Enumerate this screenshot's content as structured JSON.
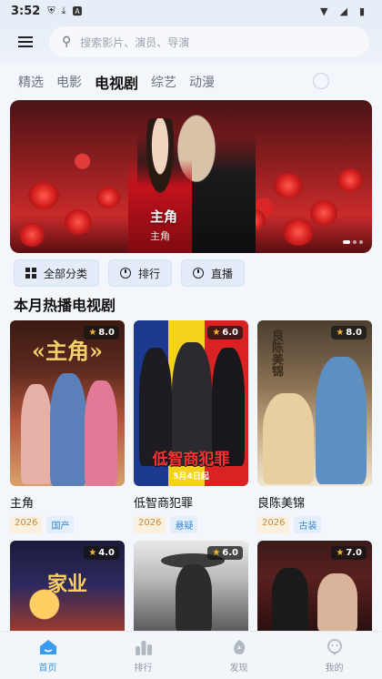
{
  "status_bar": {
    "time": "3:52"
  },
  "search": {
    "placeholder": "搜索影片、演员、导演"
  },
  "tabs": [
    {
      "label": "精选",
      "active": false
    },
    {
      "label": "电影",
      "active": false
    },
    {
      "label": "电视剧",
      "active": true
    },
    {
      "label": "综艺",
      "active": false
    },
    {
      "label": "动漫",
      "active": false
    }
  ],
  "banner": {
    "title": "主角",
    "subtitle": "主角"
  },
  "chips": [
    {
      "label": "全部分类",
      "icon": "grid-icon"
    },
    {
      "label": "排行",
      "icon": "clock-icon"
    },
    {
      "label": "直播",
      "icon": "clock-icon"
    }
  ],
  "section": {
    "title": "本月热播电视剧"
  },
  "cards": [
    {
      "name": "主角",
      "rating": "8.0",
      "year": "2026",
      "genre": "国产",
      "poster_text": "«主角»"
    },
    {
      "name": "低智商犯罪",
      "rating": "6.0",
      "year": "2026",
      "genre": "悬疑",
      "poster_text": "低智商犯罪",
      "poster_date": "5月4日起"
    },
    {
      "name": "良陈美锦",
      "rating": "8.0",
      "year": "2026",
      "genre": "古装",
      "poster_text": "良陈美锦"
    },
    {
      "name": "",
      "rating": "4.0",
      "poster_text": "家业"
    },
    {
      "name": "",
      "rating": "6.0"
    },
    {
      "name": "",
      "rating": "7.0"
    }
  ],
  "bottom_nav": [
    {
      "label": "首页",
      "icon": "home-icon",
      "active": true
    },
    {
      "label": "排行",
      "icon": "ranking-icon",
      "active": false
    },
    {
      "label": "发现",
      "icon": "discover-icon",
      "active": false
    },
    {
      "label": "我的",
      "icon": "profile-icon",
      "active": false
    }
  ],
  "colors": {
    "accent": "#3a9af0",
    "year_tag": "#d08a3a",
    "genre_tag": "#3a86d0",
    "rating_star": "#f5b825"
  }
}
